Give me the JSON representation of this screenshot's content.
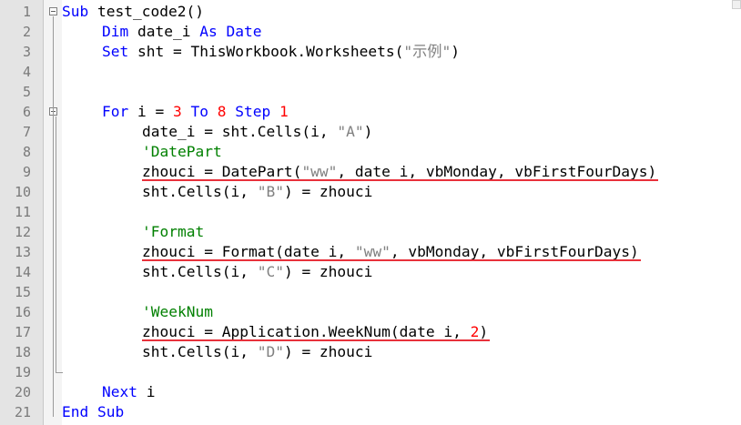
{
  "colors": {
    "keyword": "#0000ff",
    "number": "#ff0000",
    "string": "#808080",
    "comment": "#008000",
    "plain": "#000000",
    "underline": "#e8313b"
  },
  "lines": [
    {
      "num": "1",
      "tokens": [
        {
          "t": "Sub",
          "k": "keyword"
        },
        {
          "t": " test_code2()",
          "k": "plain"
        }
      ]
    },
    {
      "num": "2",
      "tokens": [
        {
          "t": "Dim",
          "k": "keyword"
        },
        {
          "t": " date_i ",
          "k": "plain"
        },
        {
          "t": "As",
          "k": "keyword"
        },
        {
          "t": " ",
          "k": "plain"
        },
        {
          "t": "Date",
          "k": "keyword"
        }
      ]
    },
    {
      "num": "3",
      "tokens": [
        {
          "t": "Set",
          "k": "keyword"
        },
        {
          "t": " sht = ThisWorkbook.Worksheets(",
          "k": "plain"
        },
        {
          "t": "\"示例\"",
          "k": "string"
        },
        {
          "t": ")",
          "k": "plain"
        }
      ]
    },
    {
      "num": "4",
      "tokens": []
    },
    {
      "num": "5",
      "tokens": []
    },
    {
      "num": "6",
      "tokens": [
        {
          "t": "For",
          "k": "keyword"
        },
        {
          "t": " i = ",
          "k": "plain"
        },
        {
          "t": "3",
          "k": "number"
        },
        {
          "t": " ",
          "k": "plain"
        },
        {
          "t": "To",
          "k": "keyword"
        },
        {
          "t": " ",
          "k": "plain"
        },
        {
          "t": "8",
          "k": "number"
        },
        {
          "t": " ",
          "k": "plain"
        },
        {
          "t": "Step",
          "k": "keyword"
        },
        {
          "t": " ",
          "k": "plain"
        },
        {
          "t": "1",
          "k": "number"
        }
      ]
    },
    {
      "num": "7",
      "tokens": [
        {
          "t": "date_i = sht.Cells(i, ",
          "k": "plain"
        },
        {
          "t": "\"A\"",
          "k": "string"
        },
        {
          "t": ")",
          "k": "plain"
        }
      ]
    },
    {
      "num": "8",
      "tokens": [
        {
          "t": "'DatePart",
          "k": "comment"
        }
      ]
    },
    {
      "num": "9",
      "tokens": [
        {
          "t": "zhouci = DatePart(",
          "k": "plain"
        },
        {
          "t": "\"ww\"",
          "k": "string"
        },
        {
          "t": ", date_i, vbMonday, vbFirstFourDays)",
          "k": "plain"
        }
      ]
    },
    {
      "num": "10",
      "tokens": [
        {
          "t": "sht.Cells(i, ",
          "k": "plain"
        },
        {
          "t": "\"B\"",
          "k": "string"
        },
        {
          "t": ") = zhouci",
          "k": "plain"
        }
      ]
    },
    {
      "num": "11",
      "tokens": []
    },
    {
      "num": "12",
      "tokens": [
        {
          "t": "'Format",
          "k": "comment"
        }
      ]
    },
    {
      "num": "13",
      "tokens": [
        {
          "t": "zhouci = Format(date_i, ",
          "k": "plain"
        },
        {
          "t": "\"ww\"",
          "k": "string"
        },
        {
          "t": ", vbMonday, vbFirstFourDays)",
          "k": "plain"
        }
      ]
    },
    {
      "num": "14",
      "tokens": [
        {
          "t": "sht.Cells(i, ",
          "k": "plain"
        },
        {
          "t": "\"C\"",
          "k": "string"
        },
        {
          "t": ") = zhouci",
          "k": "plain"
        }
      ]
    },
    {
      "num": "15",
      "tokens": []
    },
    {
      "num": "16",
      "tokens": [
        {
          "t": "'WeekNum",
          "k": "comment"
        }
      ]
    },
    {
      "num": "17",
      "tokens": [
        {
          "t": "zhouci = Application.WeekNum(date_i, ",
          "k": "plain"
        },
        {
          "t": "2",
          "k": "number"
        },
        {
          "t": ")",
          "k": "plain"
        }
      ]
    },
    {
      "num": "18",
      "tokens": [
        {
          "t": "sht.Cells(i, ",
          "k": "plain"
        },
        {
          "t": "\"D\"",
          "k": "string"
        },
        {
          "t": ") = zhouci",
          "k": "plain"
        }
      ]
    },
    {
      "num": "19",
      "tokens": []
    },
    {
      "num": "20",
      "tokens": [
        {
          "t": "Next",
          "k": "keyword"
        },
        {
          "t": " i",
          "k": "plain"
        }
      ]
    },
    {
      "num": "21",
      "tokens": [
        {
          "t": "End",
          "k": "keyword"
        },
        {
          "t": " ",
          "k": "plain"
        },
        {
          "t": "Sub",
          "k": "keyword"
        }
      ]
    }
  ]
}
